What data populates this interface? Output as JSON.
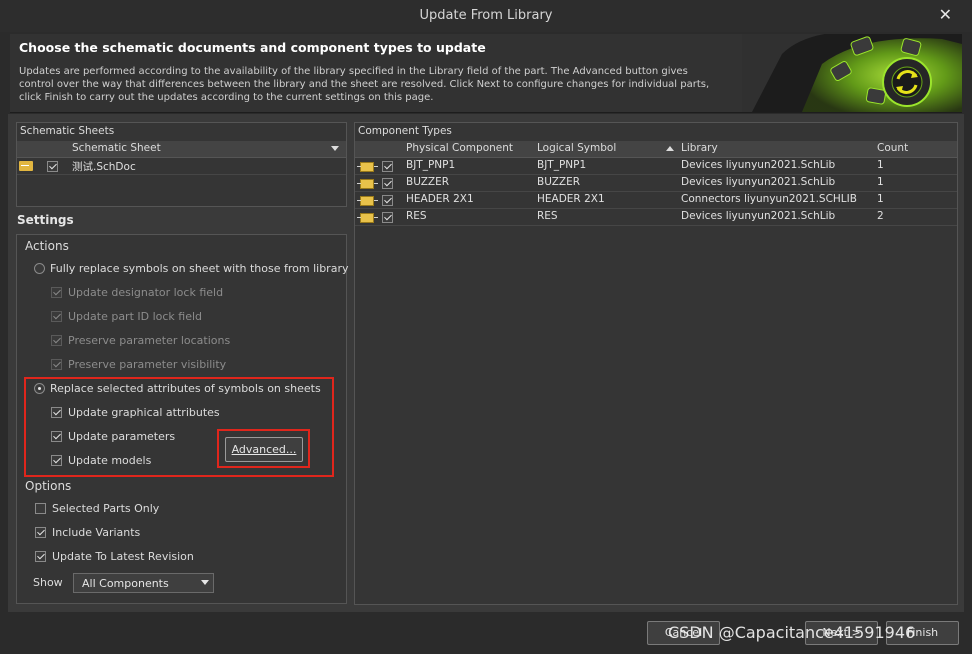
{
  "window": {
    "title": "Update From Library",
    "close_glyph": "✕"
  },
  "header": {
    "heading": "Choose the schematic documents and component types to update",
    "description": "Updates are performed according to the availability of the library specified in the Library field of the part. The Advanced button gives control over the way that differences between the library and the sheet are resolved. Click Next to configure changes for individual parts, click Finish to carry out the updates according to the current settings on this page."
  },
  "schematic_sheets": {
    "panel_title": "Schematic Sheets",
    "column": "Schematic Sheet",
    "rows": [
      {
        "name": "测试.SchDoc",
        "checked": true
      }
    ]
  },
  "settings": {
    "title": "Settings",
    "actions_label": "Actions",
    "option_full": "Fully replace symbols on sheet with those from library",
    "full_subs": [
      "Update designator lock field",
      "Update part ID lock field",
      "Preserve parameter locations",
      "Preserve parameter visibility"
    ],
    "option_replace": "Replace selected attributes of symbols on sheets",
    "replace_subs": [
      "Update graphical attributes",
      "Update parameters",
      "Update models"
    ],
    "advanced_button": "Advanced...",
    "options_label": "Options",
    "options": [
      {
        "label": "Selected Parts Only",
        "checked": false
      },
      {
        "label": "Include Variants",
        "checked": true
      },
      {
        "label": "Update To Latest Revision",
        "checked": true
      }
    ],
    "show_label": "Show",
    "show_value": "All Components"
  },
  "component_types": {
    "panel_title": "Component Types",
    "columns": [
      "Physical Component",
      "Logical Symbol",
      "Library",
      "Count"
    ],
    "rows": [
      {
        "physical": "BJT_PNP1",
        "logical": "BJT_PNP1",
        "library": "Devices liyunyun2021.SchLib",
        "count": "1"
      },
      {
        "physical": "BUZZER",
        "logical": "BUZZER",
        "library": "Devices liyunyun2021.SchLib",
        "count": "1"
      },
      {
        "physical": "HEADER 2X1",
        "logical": "HEADER 2X1",
        "library": "Connectors liyunyun2021.SCHLIB",
        "count": "1"
      },
      {
        "physical": "RES",
        "logical": "RES",
        "library": "Devices liyunyun2021.SchLib",
        "count": "2"
      }
    ]
  },
  "footer": {
    "cancel": "Cancel",
    "next": "Next >",
    "finish": "Finish"
  },
  "watermark": "CSDN @Capacitance41591946",
  "colors": {
    "highlight_box": "#e0261c",
    "accent_green": "#9be52c"
  }
}
